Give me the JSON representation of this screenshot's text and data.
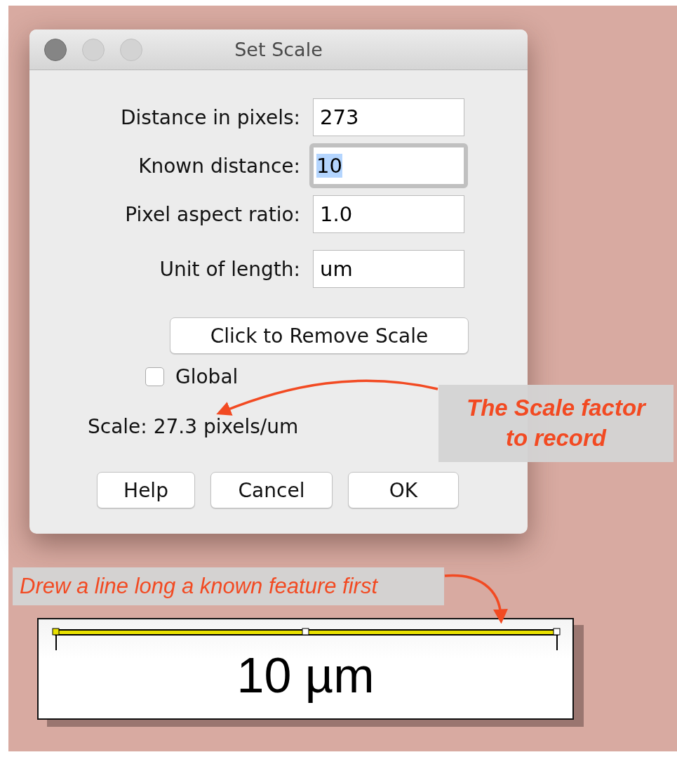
{
  "window": {
    "title": "Set Scale"
  },
  "fields": [
    {
      "label": "Distance in pixels:",
      "value": "273",
      "focused": false
    },
    {
      "label": "Known distance:",
      "value": "10",
      "focused": true
    },
    {
      "label": "Pixel aspect ratio:",
      "value": "1.0",
      "focused": false
    },
    {
      "label": "Unit of length:",
      "value": "um",
      "focused": false
    }
  ],
  "remove_button": "Click to Remove Scale",
  "global_checkbox": {
    "label": "Global",
    "checked": false
  },
  "scale_text": "Scale: 27.3 pixels/um",
  "buttons": [
    "Help",
    "Cancel",
    "OK"
  ],
  "callouts": [
    {
      "text": "The Scale factor to record",
      "kind": "box"
    },
    {
      "text": "Drew a line long a known feature first",
      "kind": "banner"
    }
  ],
  "scale_bar": {
    "label": "10 µm"
  }
}
